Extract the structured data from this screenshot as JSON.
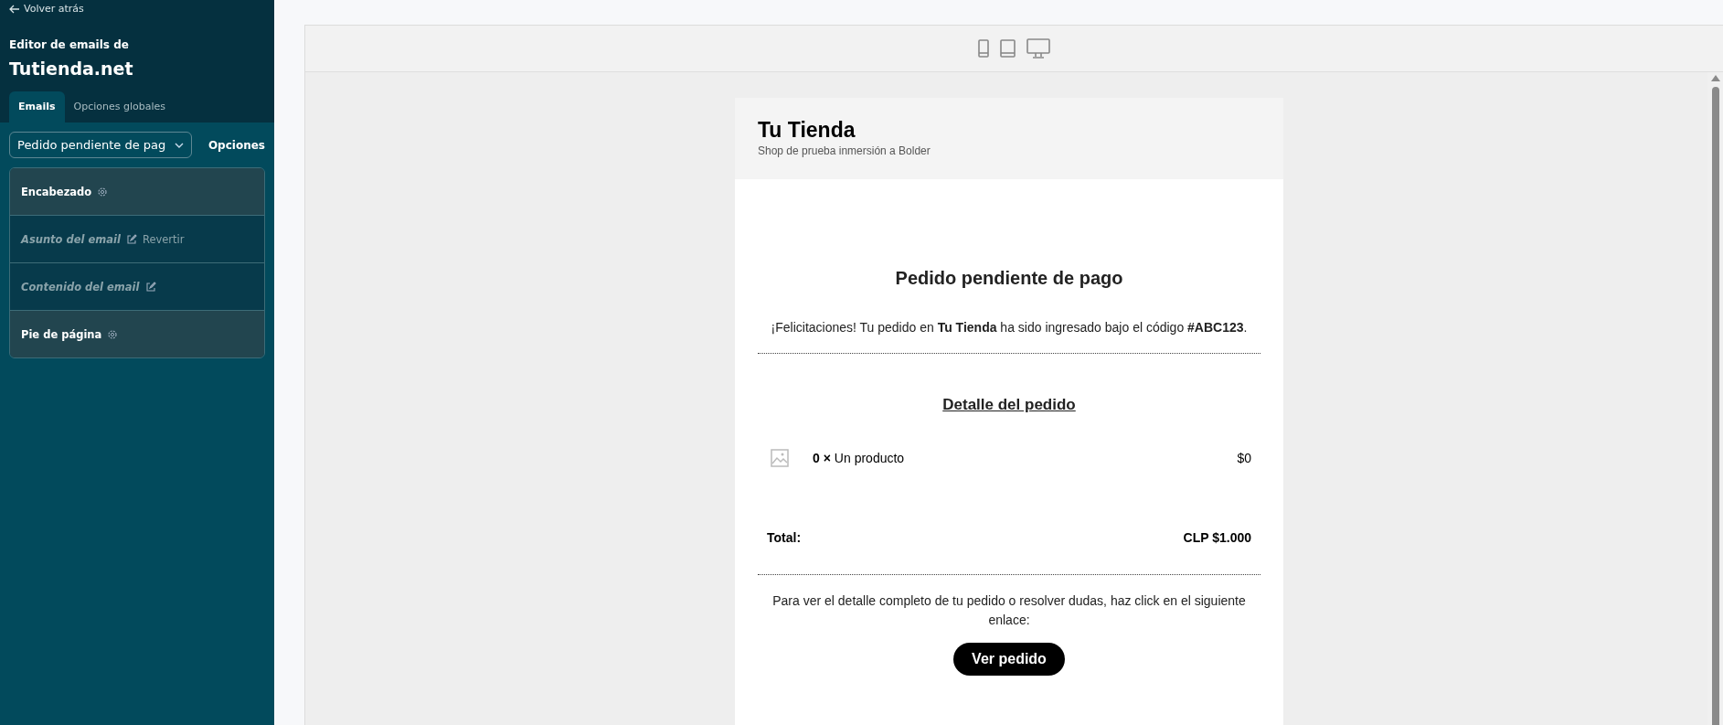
{
  "sidebar": {
    "back_link": "Volver atrás",
    "subtitle": "Editor de emails de",
    "store_name": "Tutienda.net",
    "tabs": [
      {
        "label": "Emails",
        "selected": true
      },
      {
        "label": "Opciones globales",
        "selected": false
      }
    ],
    "template_select": {
      "value": "Pedido pendiente de pag"
    },
    "options_button": "Opciones",
    "sections": [
      {
        "kind": "settings",
        "label": "Encabezado"
      },
      {
        "kind": "edit",
        "label": "Asunto del email",
        "action": "Revertir"
      },
      {
        "kind": "edit",
        "label": "Contenido del email"
      },
      {
        "kind": "settings",
        "label": "Pie de página"
      }
    ]
  },
  "preview": {
    "devices": [
      {
        "kind": "phone"
      },
      {
        "kind": "tablet"
      },
      {
        "kind": "desktop"
      }
    ],
    "email": {
      "store_title": "Tu Tienda",
      "store_tagline": "Shop de prueba inmersión a Bolder",
      "heading": "Pedido pendiente de pago",
      "intro": "¡Felicitaciones! Tu pedido en **Tu Tienda** ha sido ingresado bajo el código **#ABC123**.",
      "detail_title": "Detalle del pedido",
      "items": [
        {
          "quantity": "0 ×",
          "name": "Un producto",
          "price": "$0"
        }
      ],
      "total_label": "Total:",
      "total_value": "CLP $1.000",
      "footer_text": "Para ver el detalle completo de tu pedido o resolver dudas, haz click en el siguiente enlace:",
      "button": "Ver pedido"
    }
  }
}
